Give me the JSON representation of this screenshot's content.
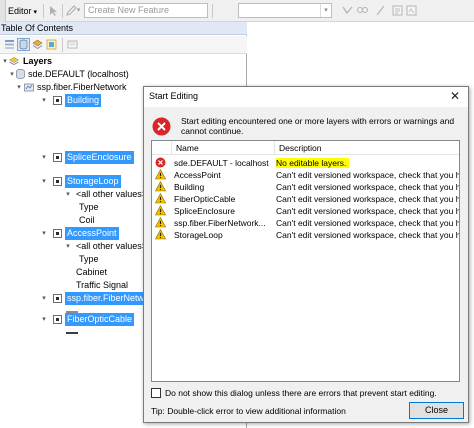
{
  "toolbar": {
    "editor_label": "Editor",
    "feature_combo_value": "Create New Feature"
  },
  "toc": {
    "title": "Table Of Contents",
    "root_label": "Layers",
    "connection_label": "sde.DEFAULT (localhost)",
    "dataset_label": "ssp.fiber.FiberNetwork",
    "layers": {
      "building": "Building",
      "splice_enclosure": "SpliceEnclosure",
      "storage_loop": "StorageLoop",
      "storage_loop_other": "<all other values>",
      "storage_loop_type": "Type",
      "storage_loop_coil": "Coil",
      "access_point": "AccessPoint",
      "access_point_other": "<all other values>",
      "access_point_type": "Type",
      "access_point_cabinet": "Cabinet",
      "access_point_signal": "Traffic Signal",
      "fiber_network": "ssp.fiber.FiberNetwo",
      "fiber_optic_cable": "FiberOpticCable"
    }
  },
  "dialog": {
    "title": "Start Editing",
    "close_glyph": "✕",
    "message": "Start editing encountered one or more layers with errors or warnings and cannot continue.",
    "columns": {
      "name": "Name",
      "description": "Description"
    },
    "rows": [
      {
        "type": "error",
        "name": "sde.DEFAULT - localhost",
        "description": "No editable layers."
      },
      {
        "type": "warning",
        "name": "AccessPoint",
        "description": "Can't edit versioned workspace, check that you have ..."
      },
      {
        "type": "warning",
        "name": "Building",
        "description": "Can't edit versioned workspace, check that you have ..."
      },
      {
        "type": "warning",
        "name": "FiberOpticCable",
        "description": "Can't edit versioned workspace, check that you have ..."
      },
      {
        "type": "warning",
        "name": "SpliceEnclosure",
        "description": "Can't edit versioned workspace, check that you have ..."
      },
      {
        "type": "warning",
        "name": "ssp.fiber.FiberNetwork...",
        "description": "Can't edit versioned workspace, check that you have ..."
      },
      {
        "type": "warning",
        "name": "StorageLoop",
        "description": "Can't edit versioned workspace, check that you have ..."
      }
    ],
    "dont_show_label": "Do not show this dialog unless there are errors that prevent start editing.",
    "tip": "Tip: Double-click error to view additional information",
    "close_button": "Close"
  },
  "colors": {
    "selection": "#3399ff",
    "highlight": "#ffff00",
    "error": "#d9262a",
    "warning": "#f2c200"
  }
}
